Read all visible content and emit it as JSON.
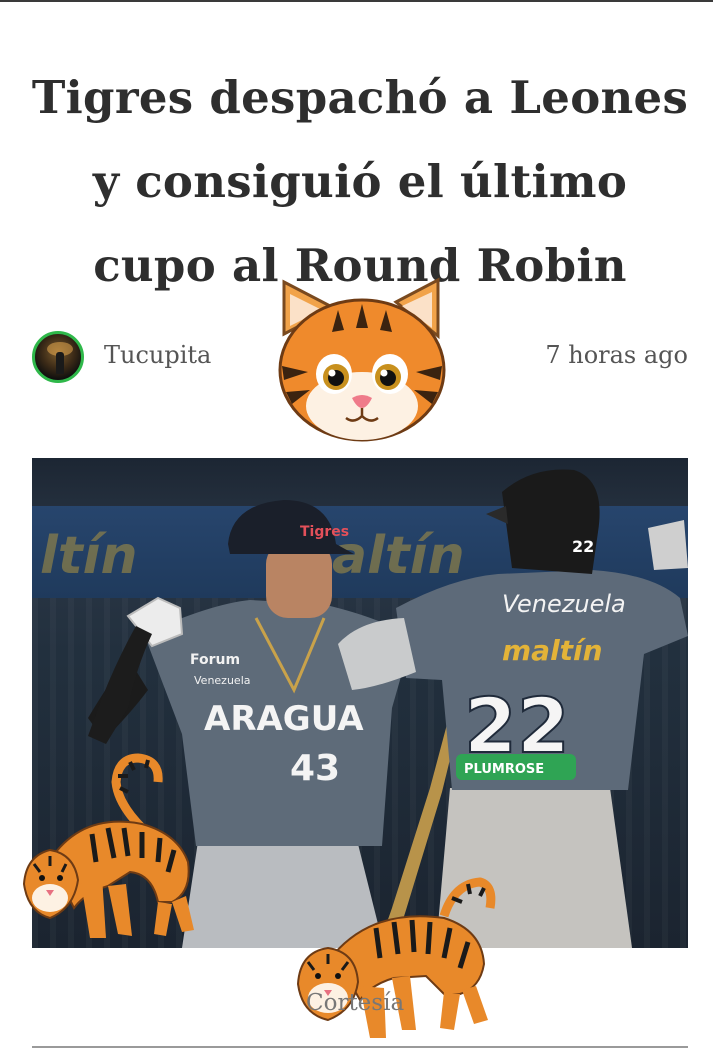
{
  "article": {
    "title": "Tigres despachó a Leones y consiguió el último cupo al Round Robin",
    "author": "Tucupita",
    "time": "7 horas ago",
    "caption": "Cortesía"
  },
  "photo": {
    "left_player": {
      "team": "ARAGUA",
      "number": "43",
      "sponsor": "Forum",
      "sub": "Venezuela",
      "cap_logo": "Tigres"
    },
    "right_player": {
      "team": "Venezuela",
      "sponsor": "maltín",
      "number": "22",
      "helmet_number": "22",
      "bottom": "PLUMROSE"
    },
    "banner": [
      "ltín",
      "altín"
    ]
  },
  "stickers": [
    "tiger-face-sticker",
    "tiger-sticker-left",
    "tiger-sticker-bottom"
  ],
  "colors": {
    "title": "#2e2e2e",
    "meta_text": "#555555",
    "avatar_ring": "#2fb84a",
    "jersey": "#5b6877",
    "tiger_orange": "#e8892a"
  }
}
